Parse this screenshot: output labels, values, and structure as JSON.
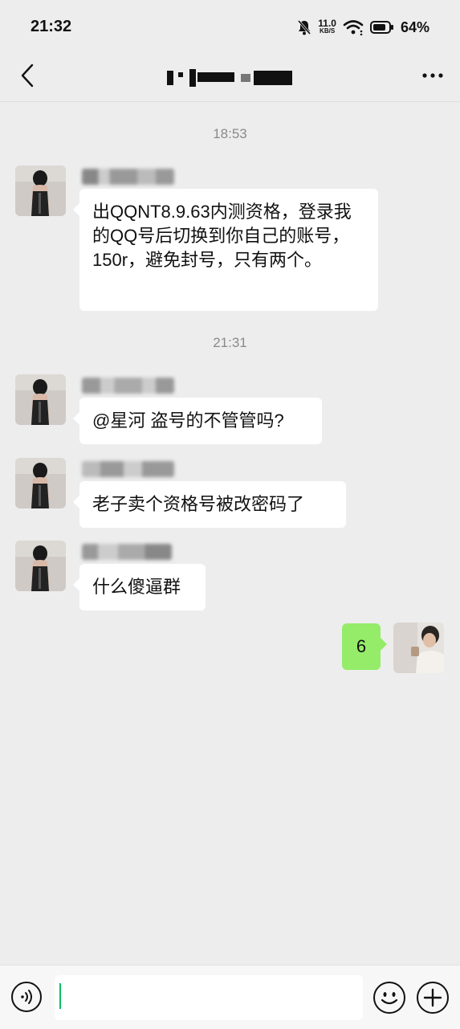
{
  "status_bar": {
    "time": "21:32",
    "net_speed_value": "11.0",
    "net_speed_unit": "KB/S",
    "battery_percent": "64%"
  },
  "header": {
    "back_icon": "chevron-left-icon",
    "more_icon": "more-horizontal-icon"
  },
  "chat": {
    "timestamps": [
      "18:53",
      "21:31"
    ],
    "messages": [
      {
        "side": "left",
        "text": "出QQNT8.9.63内测资格，登录我的QQ号后切换到你自己的账号，150r，避免封号，只有两个。"
      },
      {
        "side": "left",
        "text": "@星河 盗号的不管管吗?"
      },
      {
        "side": "left",
        "text": "老子卖个资格号被改密码了"
      },
      {
        "side": "left",
        "text": "什么傻逼群"
      },
      {
        "side": "right",
        "text": "6"
      }
    ]
  },
  "input_bar": {
    "placeholder": "",
    "voice_icon": "voice-icon",
    "emoji_icon": "emoji-icon",
    "plus_icon": "plus-icon"
  },
  "colors": {
    "background": "#ededed",
    "bubble_left": "#ffffff",
    "bubble_right": "#95ec69",
    "caret": "#07c160"
  }
}
